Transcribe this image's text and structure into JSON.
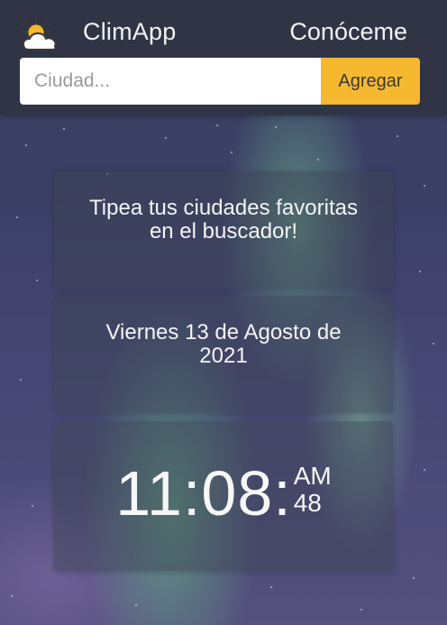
{
  "header": {
    "app_name": "ClimApp",
    "about_label": "Conóceme",
    "logo_icon": "sun-behind-cloud-icon"
  },
  "search": {
    "placeholder": "Ciudad...",
    "value": "",
    "add_label": "Agregar"
  },
  "cards": {
    "message": "Tipea tus ciudades favoritas en el buscador!",
    "date": "Viernes 13 de Agosto de 2021"
  },
  "clock": {
    "time": "11:08:",
    "meridiem": "AM",
    "seconds": "48"
  },
  "colors": {
    "header_bg": "#30344a",
    "accent": "#f6b82f",
    "text": "#f4f4f4"
  }
}
